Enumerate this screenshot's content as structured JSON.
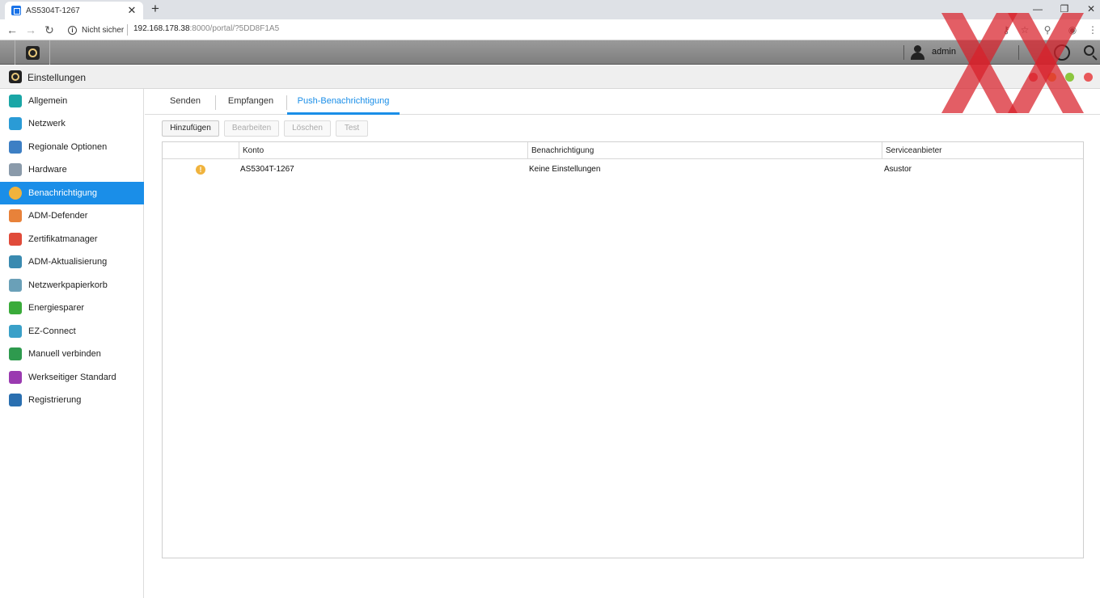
{
  "browser": {
    "tab_title": "AS5304T-1267",
    "tab_close": "✕",
    "new_tab": "+",
    "win_minimize": "—",
    "win_restore": "❐",
    "win_close": "✕",
    "back": "←",
    "forward": "→",
    "reload": "↻",
    "security_label": "Nicht sicher",
    "url_host": "192.168.178.38",
    "url_rest": ":8000/portal/?5DD8F1A5",
    "menu": "⋮"
  },
  "adm_bar": {
    "username": "admin"
  },
  "window": {
    "title": "Einstellungen",
    "dot_colors": [
      "#e8585a",
      "#f2a742",
      "#8cc63f",
      "#e8585a"
    ]
  },
  "sidebar": {
    "items": [
      {
        "label": "Allgemein",
        "icon": "general-icon",
        "color": "#1aa6a6"
      },
      {
        "label": "Netzwerk",
        "icon": "globe-icon",
        "color": "#2a9bd6"
      },
      {
        "label": "Regionale Optionen",
        "icon": "region-icon",
        "color": "#3d7fc4"
      },
      {
        "label": "Hardware",
        "icon": "hardware-icon",
        "color": "#8a9aaa"
      },
      {
        "label": "Benachrichtigung",
        "icon": "notification-icon",
        "color": "#f0b33d"
      },
      {
        "label": "ADM-Defender",
        "icon": "firewall-icon",
        "color": "#e8823a"
      },
      {
        "label": "Zertifikatmanager",
        "icon": "certificate-icon",
        "color": "#e04b3a"
      },
      {
        "label": "ADM-Aktualisierung",
        "icon": "update-icon",
        "color": "#3a8ab0"
      },
      {
        "label": "Netzwerkpapierkorb",
        "icon": "recycle-bin-icon",
        "color": "#6aa0b8"
      },
      {
        "label": "Energiesparer",
        "icon": "energy-icon",
        "color": "#3aab3a"
      },
      {
        "label": "EZ-Connect",
        "icon": "cloud-icon",
        "color": "#3aa0c8"
      },
      {
        "label": "Manuell verbinden",
        "icon": "connect-icon",
        "color": "#2e9a4e"
      },
      {
        "label": "Werkseitiger Standard",
        "icon": "reset-icon",
        "color": "#9a3ab0"
      },
      {
        "label": "Registrierung",
        "icon": "registration-icon",
        "color": "#2a6fb0"
      }
    ],
    "active_index": 4
  },
  "content": {
    "tabs": [
      {
        "label": "Senden"
      },
      {
        "label": "Empfangen"
      },
      {
        "label": "Push-Benachrichtigung"
      }
    ],
    "active_tab": 2,
    "toolbar": {
      "add": "Hinzufügen",
      "edit": "Bearbeiten",
      "delete": "Löschen",
      "test": "Test"
    },
    "table": {
      "columns": [
        "Konto",
        "Benachrichtigung",
        "Serviceanbieter"
      ],
      "rows": [
        {
          "status_icon": "!",
          "account": "AS5304T-1267",
          "notification": "Keine Einstellungen",
          "provider": "Asustor"
        }
      ]
    }
  }
}
